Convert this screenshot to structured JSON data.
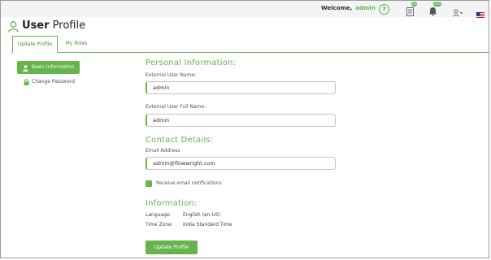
{
  "header": {
    "welcome_label": "Welcome,",
    "username": "admin",
    "help_glyph": "?",
    "messages_badge": "20",
    "notifications_badge": "120"
  },
  "page": {
    "title_bold": "User",
    "title_rest": " Profile"
  },
  "tabs": [
    {
      "label": "Update Profile"
    },
    {
      "label": "My Roles"
    }
  ],
  "sidebar": {
    "items": [
      {
        "label": "Basic Information"
      },
      {
        "label": "Change Password"
      }
    ]
  },
  "form": {
    "personal_heading": "Personal Information:",
    "ext_user_name_label": "External User Name:",
    "ext_user_name_value": "admin",
    "ext_full_name_label": "External User Full Name:",
    "ext_full_name_value": "admin",
    "contact_heading": "Contact Details:",
    "email_label": "Email Address",
    "email_value": "admin@flowwright.com",
    "receive_notifications_label": "Receive email notifications",
    "receive_notifications_checked": true,
    "info_heading": "Information:",
    "language_key": "Language:",
    "language_value": "English (en-US)",
    "timezone_key": "Time Zone:",
    "timezone_value": "India Standard Time",
    "submit_label": "Update Profile"
  },
  "colors": {
    "accent": "#66b44c",
    "topbar_bg": "#f3f4f6"
  }
}
